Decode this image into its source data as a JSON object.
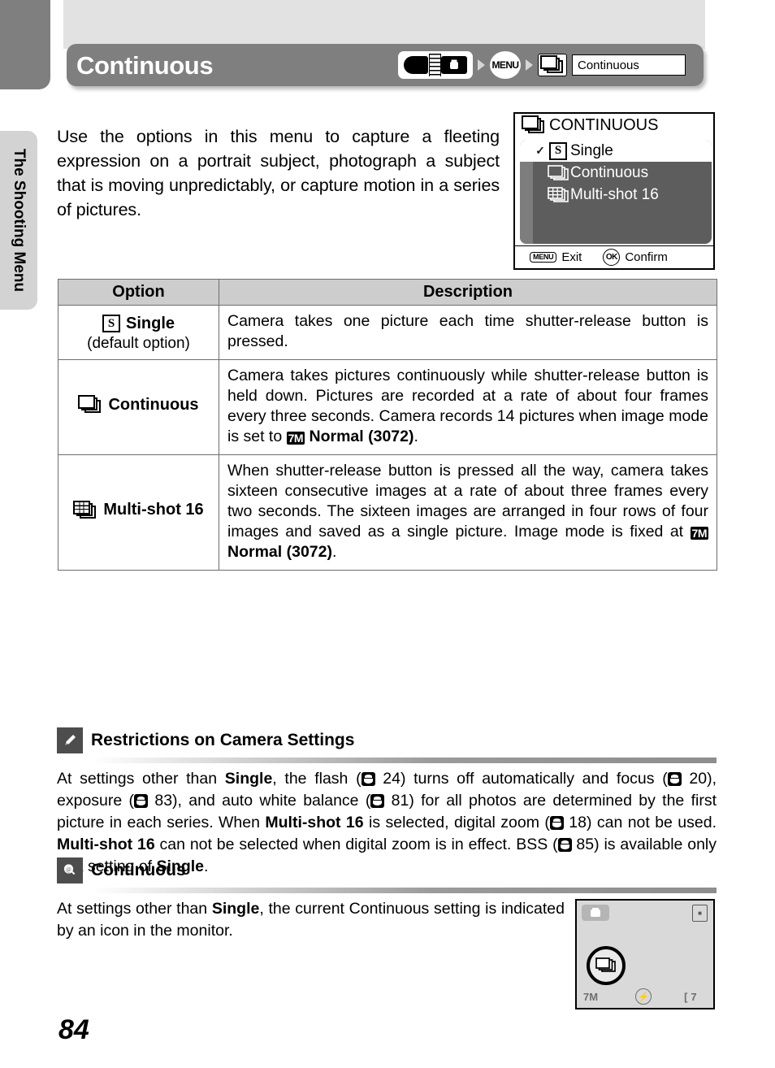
{
  "page": {
    "number": "84",
    "side_tab": "The Shooting Menu"
  },
  "header": {
    "title": "Continuous",
    "breadcrumb": {
      "mode_dial_icon": "camera-mode-dial-icon",
      "menu_label": "MENU",
      "continuous_icon": "continuous-stack-icon",
      "field_value": "Continuous"
    }
  },
  "intro": {
    "text": "Use the options in this menu to capture a fleeting expression on a portrait subject, photograph a subject that is moving unpredictably, or capture motion in a series of pictures."
  },
  "lcd_menu": {
    "title": "CONTINUOUS",
    "title_icon": "continuous-stack-icon",
    "rows": [
      {
        "check": "✓",
        "icon": "single-s-icon",
        "label": "Single",
        "selected": true
      },
      {
        "check": "",
        "icon": "continuous-stack-icon",
        "label": "Continuous",
        "selected": false
      },
      {
        "check": "",
        "icon": "multishot-grid-icon",
        "label": "Multi-shot 16",
        "selected": false
      }
    ],
    "footer": {
      "exit_key": "MENU",
      "exit_label": "Exit",
      "confirm_key": "OK",
      "confirm_label": "Confirm"
    }
  },
  "table": {
    "headers": [
      "Option",
      "Description"
    ],
    "rows": [
      {
        "icon": "single-s-icon",
        "name": "Single",
        "sub": "(default option)",
        "description": "Camera takes one picture each time shutter-release button is pressed."
      },
      {
        "icon": "continuous-stack-icon",
        "name": "Continuous",
        "sub": "",
        "desc_part1": "Camera takes pictures continuously while shutter-release button is held down. Pictures are recorded at a rate of about four frames every three seconds. Camera records 14 pictures when image mode is set to ",
        "image_mode_icon": "7M",
        "desc_part2": "Normal (3072)",
        "desc_part3": "."
      },
      {
        "icon": "multishot-grid-icon",
        "name": "Multi-shot 16",
        "sub": "",
        "desc_part1": "When shutter-release button is pressed all the way, camera takes sixteen consecutive images at a rate of about three frames every two seconds. The sixteen images are arranged in four rows of four images and saved as a single picture. Image mode is fixed at ",
        "image_mode_icon": "7M",
        "desc_part2": "Normal (3072)",
        "desc_part3": "."
      }
    ]
  },
  "notes": [
    {
      "badge_icon": "pencil-note-icon",
      "title": "Restrictions on Camera Settings",
      "segments": [
        {
          "t": "At settings other than "
        },
        {
          "t": "Single",
          "b": true
        },
        {
          "t": ", the flash ("
        },
        {
          "t": "◉",
          "ref": true
        },
        {
          "t": " 24) turns off automatically and focus ("
        },
        {
          "t": "◉",
          "ref": true
        },
        {
          "t": " 20), exposure ("
        },
        {
          "t": "◉",
          "ref": true
        },
        {
          "t": " 83), and auto white balance ("
        },
        {
          "t": "◉",
          "ref": true
        },
        {
          "t": " 81) for all photos are determined by the first picture in each series. When "
        },
        {
          "t": "Multi-shot 16",
          "b": true
        },
        {
          "t": " is selected, digital zoom ("
        },
        {
          "t": "◉",
          "ref": true
        },
        {
          "t": " 18) can not be used. "
        },
        {
          "t": "Multi-shot 16",
          "b": true
        },
        {
          "t": " can not be selected when digital zoom is in effect. BSS ("
        },
        {
          "t": "◉",
          "ref": true
        },
        {
          "t": " 85) is available only at a setting of "
        },
        {
          "t": "Single",
          "b": true
        },
        {
          "t": "."
        }
      ]
    },
    {
      "badge_icon": "lightbulb-tip-icon",
      "title": "Continuous",
      "segments": [
        {
          "t": "At settings other than "
        },
        {
          "t": "Single",
          "b": true
        },
        {
          "t": ", the current Continuous setting is indicated by an icon in the monitor."
        }
      ]
    }
  ],
  "monitor": {
    "mode_icon": "camera-mode-icon",
    "battery_icon": "battery-icon",
    "continuous_indicator_icon": "continuous-stack-icon",
    "image_mode": "7M",
    "flash_icon": "flash-off-icon",
    "frames_remaining": "7"
  },
  "colors": {
    "title_bar": "#7f7f7f",
    "table_header": "#cdcdcd",
    "side_tab": "#d3d3d3",
    "lcd_body": "#5d5d5d",
    "note_badge": "#4d4d4d"
  }
}
